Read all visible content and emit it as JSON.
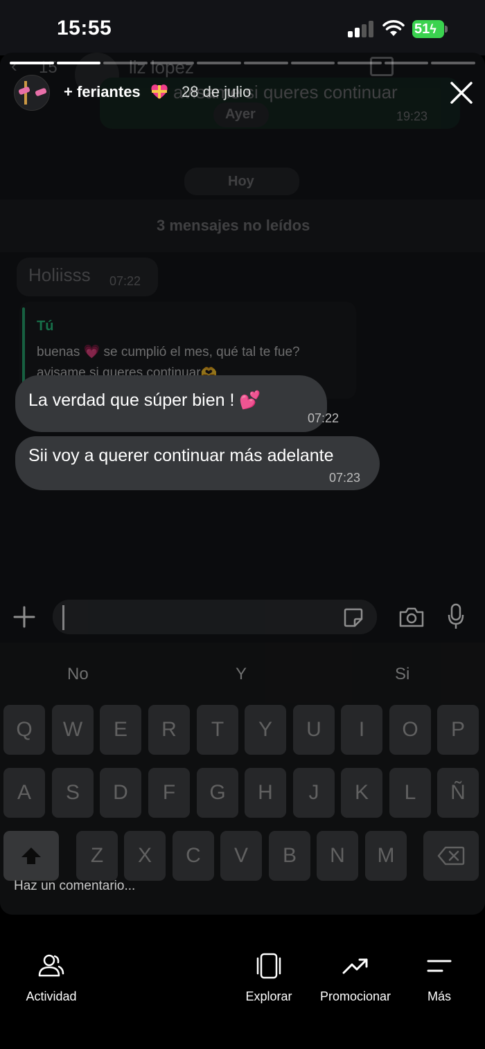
{
  "status_bar": {
    "time": "15:55",
    "battery": "51"
  },
  "story": {
    "account_name": "+ feriantes",
    "date": "28 de julio"
  },
  "background_chat": {
    "back_count": "15",
    "contact_name": "liz lopez",
    "prev_text": "avisame si queres continuar",
    "prev_time": "19:23",
    "day_ayer": "Ayer",
    "day_hoy": "Hoy",
    "unread_label": "3 mensajes no leídos",
    "message_holiiss": "Holiisss",
    "message_holiiss_time": "07:22"
  },
  "reply_quote": {
    "author": "Tú",
    "line1": "buenas 💗  se cumplió el mes, qué tal te fue?",
    "line2": "avisame si queres continuar🫶"
  },
  "messages": [
    {
      "text": "La verdad que súper bien ! 💕",
      "time": "07:22"
    },
    {
      "text": "Sii voy a querer continuar más adelante",
      "time": "07:23"
    }
  ],
  "keyboard": {
    "suggestions": [
      "No",
      "Y",
      "Si"
    ],
    "row1": [
      "Q",
      "W",
      "E",
      "R",
      "T",
      "Y",
      "U",
      "I",
      "O",
      "P"
    ],
    "row2": [
      "A",
      "S",
      "D",
      "F",
      "G",
      "H",
      "J",
      "K",
      "L",
      "Ñ"
    ],
    "row3": [
      "Z",
      "X",
      "C",
      "V",
      "B",
      "N",
      "M"
    ]
  },
  "comment_placeholder": "Haz un comentario...",
  "bottom_nav": {
    "activity": "Actividad",
    "explore": "Explorar",
    "promote": "Promocionar",
    "more": "Más"
  },
  "colors": {
    "battery": "#3ad34f",
    "bubble": "#36383b",
    "reply_accent": "#21a66b"
  }
}
